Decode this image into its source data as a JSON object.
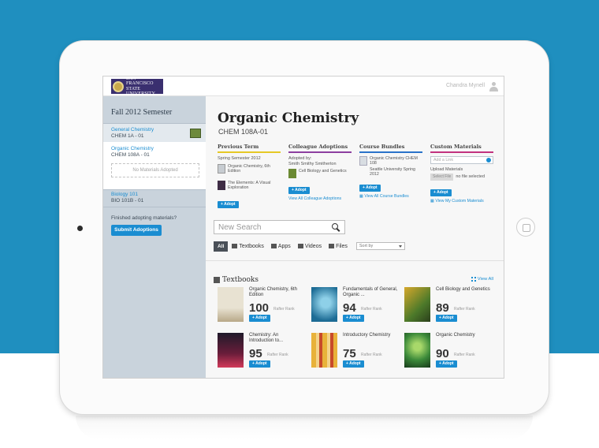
{
  "header": {
    "logo_text": "SAN FRANCISCO STATE UNIVERSITY",
    "user_name": "Chandra Mynell"
  },
  "sidebar": {
    "semester": "Fall 2012 Semester",
    "courses": [
      {
        "title": "General Chemistry",
        "code": "CHEM 1A - 01"
      },
      {
        "title": "Organic Chemistry",
        "code": "CHEM 108A - 01"
      },
      {
        "title": "Biology 101",
        "code": "BIO 101B - 01"
      }
    ],
    "no_materials": "No Materials Adopted",
    "finished_text": "Finished adopting materials?",
    "submit_label": "Submit Adoptions"
  },
  "main": {
    "title": "Organic Chemistry",
    "code": "CHEM 108A-01",
    "previous_term": {
      "heading": "Previous Term",
      "term": "Spring Semester 2012",
      "items": [
        "Organic Chemistry, 6th Edition",
        "The Elements: A Visual Exploration"
      ],
      "adopt_label": "Adopt"
    },
    "colleague": {
      "heading": "Colleague Adoptions",
      "adopted_by": "Adopted by:",
      "name": "Smith Smithy Smitherton",
      "item": "Cell Biology and Genetics",
      "adopt_label": "Adopt",
      "view_all": "View All Colleague Adoptions"
    },
    "bundles": {
      "heading": "Course Bundles",
      "item_a": "Organic Chemistry CHEM 108",
      "item_b": "Seattle University Spring 2012",
      "adopt_label": "Adopt",
      "view_all": "View All Course Bundles"
    },
    "custom": {
      "heading": "Custom Materials",
      "link_placeholder": "Add a Link",
      "upload_label": "Upload Materials",
      "select_file": "Select File",
      "no_file": "no file selected",
      "adopt_label": "Adopt",
      "view_all": "View My Custom Materials"
    },
    "search_placeholder": "New Search",
    "filters": {
      "all": "All",
      "textbooks": "Textbooks",
      "apps": "Apps",
      "videos": "Videos",
      "files": "Files",
      "sort": "Sort by"
    },
    "textbooks_heading": "Textbooks",
    "view_all": "View All",
    "rank_label": "Rafter Rank",
    "adopt_label": "Adopt",
    "books": [
      {
        "title": "Organic Chemistry, 6th Edition",
        "rank": "100"
      },
      {
        "title": "Fundamentals of General, Organic ...",
        "rank": "94"
      },
      {
        "title": "Cell Biology and Genetics",
        "rank": "89"
      },
      {
        "title": "Chemistry: An Introduction to...",
        "rank": "95"
      },
      {
        "title": "Introductory Chemistry",
        "rank": "75"
      },
      {
        "title": "Organic Chemistry",
        "rank": "90"
      }
    ]
  },
  "colors": {
    "background": "#1f8fbf",
    "accent": "#1a8dd1",
    "previous_term_bar": "#e6c825",
    "colleague_bar": "#8c3fa0",
    "bundles_bar": "#2a73c9",
    "custom_bar": "#c2327f"
  }
}
